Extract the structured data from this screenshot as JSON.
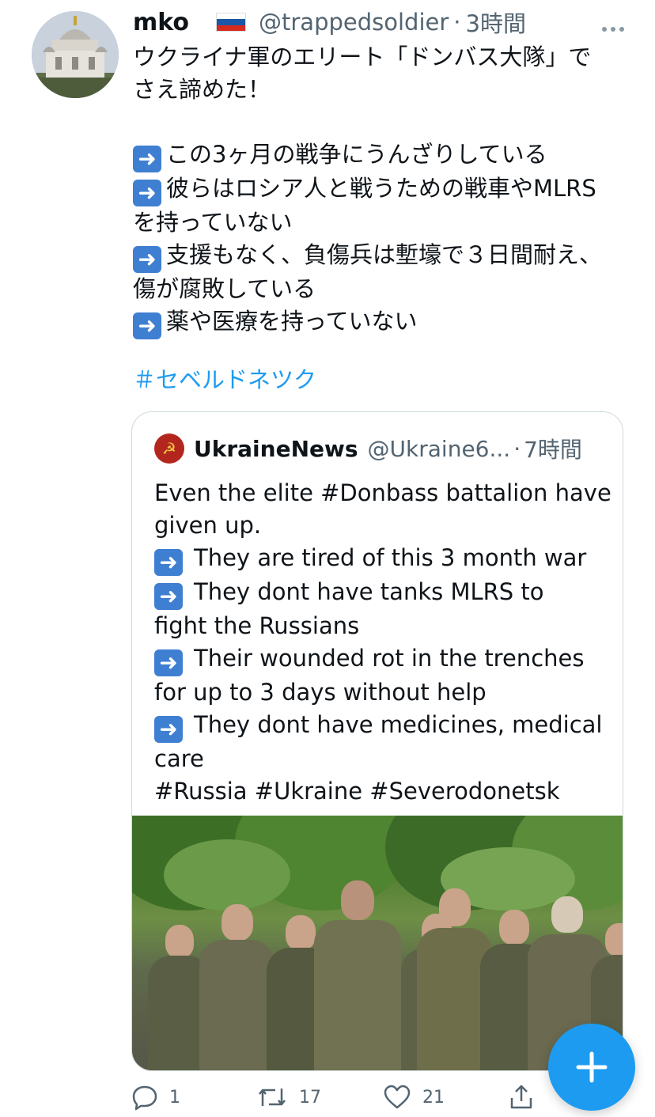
{
  "tweet": {
    "author_name": "mko",
    "author_handle": "@trappedsoldier",
    "separator": "·",
    "timestamp": "3時間",
    "more_icon": "more-icon",
    "flag_emoji": "russian-flag",
    "text_lines": [
      "ウクライナ軍のエリート「ドンバス大隊」で",
      "さえ諦めた！",
      "",
      "この3ヶ月の戦争にうんざりしている",
      "彼らはロシア人と戦うための戦車やMLRS",
      "を持っていない",
      "支援もなく、負傷兵は塹壕で３日間耐え、",
      "傷が腐敗している",
      "薬や医療を持っていない"
    ],
    "hashtag": "＃セベルドネツク"
  },
  "quoted_tweet": {
    "author_name": "UkraineNews",
    "author_handle": "@Ukraine6...",
    "separator": "·",
    "timestamp": "7時間",
    "text_lines": [
      "Even the elite #Donbass battalion have",
      "given up.",
      "They are tired of this 3 month war",
      "They dont have tanks MLRS to",
      "fight the Russians",
      "Their wounded rot in the trenches",
      "for up to 3 days without help",
      "They dont have medicines, medical",
      "care",
      "#Russia #Ukraine #Severodonetsk"
    ]
  },
  "actions": {
    "reply_count": "1",
    "retweet_count": "17",
    "like_count": "21"
  },
  "colors": {
    "accent": "#1d9bf0",
    "secondary_text": "#536471",
    "arrow_emoji_bg": "#3f7fd2"
  },
  "icons": [
    "more-icon",
    "russian-flag",
    "arrow-right-emoji",
    "reply-icon",
    "retweet-icon",
    "like-icon",
    "share-icon",
    "compose-plus-icon"
  ]
}
